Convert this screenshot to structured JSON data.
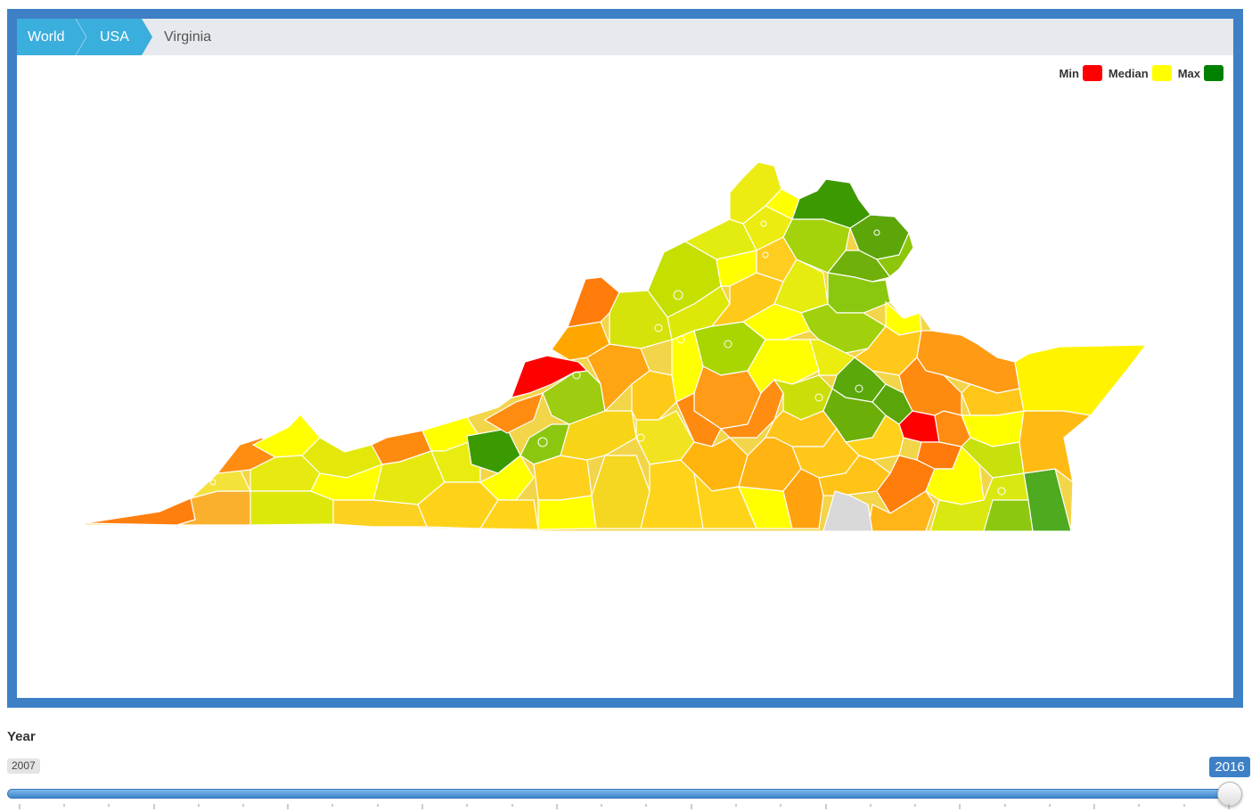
{
  "breadcrumb": {
    "items": [
      {
        "label": "World"
      },
      {
        "label": "USA"
      }
    ],
    "current": "Virginia"
  },
  "legend": {
    "min_label": "Min",
    "median_label": "Median",
    "max_label": "Max",
    "min_color": "#ff0000",
    "median_color": "#ffff00",
    "max_color": "#008000"
  },
  "colors": {
    "frame": "#3d80c6",
    "breadcrumb_active": "#3aaedc",
    "no_data": "#d9d9d9"
  },
  "slider": {
    "label": "Year",
    "min_value": "2007",
    "max_value": "2016"
  }
}
